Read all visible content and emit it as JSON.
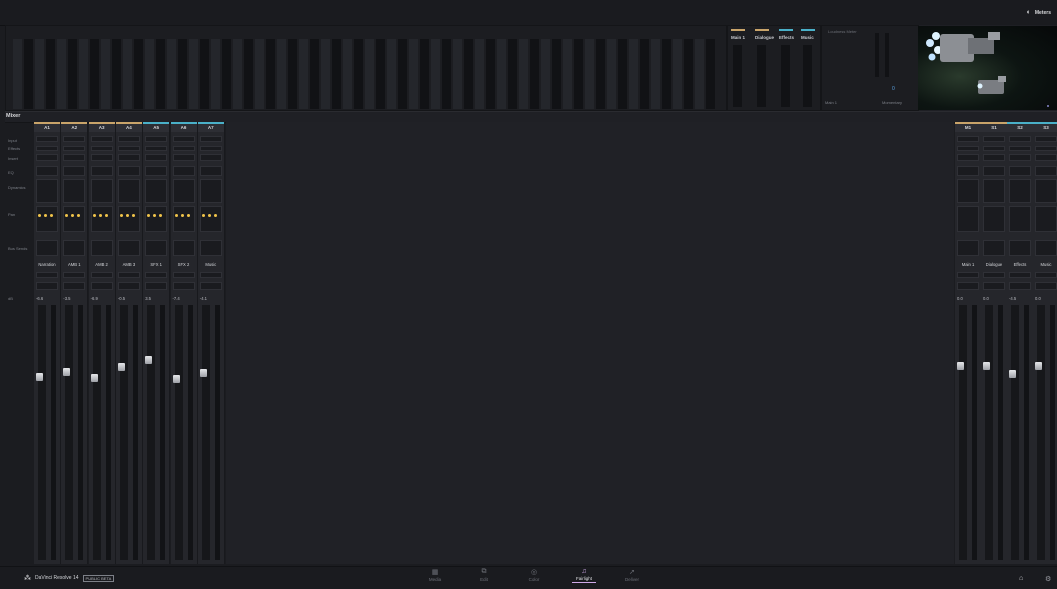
{
  "header": {
    "meters_label": "Meters"
  },
  "meters": {
    "bus_labels": [
      {
        "name": "Main 1",
        "color": "#c9a46a"
      },
      {
        "name": "Dialogue",
        "color": "#c9a46a"
      },
      {
        "name": "Effects",
        "color": "#4ab0c8"
      },
      {
        "name": "Music",
        "color": "#4ab0c8"
      }
    ],
    "loudness_header": "Loudness Meter",
    "loudness_value": "0",
    "loudness_bus": "Main 1",
    "loudness_mode": "Momentary",
    "scale": [
      "0",
      "-5",
      "-10",
      "-15",
      "-20",
      "-30",
      "-40",
      "-50"
    ]
  },
  "mixer": {
    "title": "Mixer",
    "row_labels": [
      "Input",
      "Effects",
      "Insert",
      "EQ",
      "Dynamics",
      "Pan",
      "Bus Sends"
    ],
    "gain_label": "dB",
    "tracks": [
      {
        "id": "A1",
        "name": "Narration",
        "gain": "-6.6",
        "color": "#c9a46a"
      },
      {
        "id": "A2",
        "name": "AMB 1",
        "gain": "-3.5",
        "color": "#c9a46a"
      },
      {
        "id": "A3",
        "name": "AMB 2",
        "gain": "-6.9",
        "color": "#c9a46a"
      },
      {
        "id": "A4",
        "name": "AMB 3",
        "gain": "-0.5",
        "color": "#c9a46a"
      },
      {
        "id": "A5",
        "name": "SFX 1",
        "gain": "3.5",
        "color": "#4ab0c8"
      },
      {
        "id": "A6",
        "name": "SFX 2",
        "gain": "-7.4",
        "color": "#4ab0c8"
      },
      {
        "id": "A7",
        "name": "Music",
        "gain": "-4.1",
        "color": "#4ab0c8"
      }
    ],
    "buses": [
      {
        "id": "M1",
        "name": "Main 1",
        "gain": "0.0",
        "color": "#c9a46a"
      },
      {
        "id": "S1",
        "name": "Dialogue",
        "gain": "0.0",
        "color": "#c9a46a"
      },
      {
        "id": "S2",
        "name": "Effects",
        "gain": "-4.5",
        "color": "#4ab0c8"
      },
      {
        "id": "S3",
        "name": "Music",
        "gain": "0.0",
        "color": "#4ab0c8"
      }
    ]
  },
  "footer": {
    "app_name": "DaVinci Resolve 14",
    "beta_badge": "PUBLIC BETA",
    "pages": [
      {
        "label": "Media",
        "icon": "media-icon"
      },
      {
        "label": "Edit",
        "icon": "edit-icon"
      },
      {
        "label": "Color",
        "icon": "color-icon"
      },
      {
        "label": "Fairlight",
        "icon": "fairlight-icon",
        "active": true
      },
      {
        "label": "Deliver",
        "icon": "deliver-icon"
      }
    ]
  }
}
